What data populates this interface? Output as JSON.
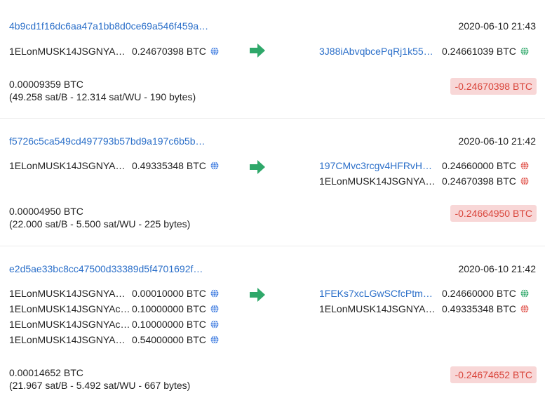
{
  "transactions": [
    {
      "hash": "4b9cd1f16dc6aa47a1bb8d0ce69a546f459a…",
      "time": "2020-06-10 21:43",
      "inputs": [
        {
          "address": "1ELonMUSK14JSGNYA…",
          "amount": "0.24670398 BTC",
          "status": "globe"
        }
      ],
      "outputs": [
        {
          "address": "3J88iAbvqbcePqRj1k55…",
          "amount": "0.24661039 BTC",
          "status": "unspent",
          "color": "#2fa86a",
          "link": true
        }
      ],
      "fee": "0.00009359 BTC",
      "fee_detail": "(49.258 sat/B - 12.314 sat/WU - 190 bytes)",
      "total": "-0.24670398 BTC"
    },
    {
      "hash": "f5726c5ca549cd497793b57bd9a197c6b5b…",
      "time": "2020-06-10 21:42",
      "inputs": [
        {
          "address": "1ELonMUSK14JSGNYA…",
          "amount": "0.49335348 BTC",
          "status": "globe"
        }
      ],
      "outputs": [
        {
          "address": "197CMvc3rcgv4HFRvH…",
          "amount": "0.24660000 BTC",
          "status": "spent",
          "color": "#e0524a",
          "link": true
        },
        {
          "address": "1ELonMUSK14JSGNYA…",
          "amount": "0.24670398 BTC",
          "status": "spent",
          "color": "#e0524a",
          "link": false
        }
      ],
      "fee": "0.00004950 BTC",
      "fee_detail": "(22.000 sat/B - 5.500 sat/WU - 225 bytes)",
      "total": "-0.24664950 BTC"
    },
    {
      "hash": "e2d5ae33bc8cc47500d33389d5f4701692f…",
      "time": "2020-06-10 21:42",
      "inputs": [
        {
          "address": "1ELonMUSK14JSGNYA…",
          "amount": "0.00010000 BTC",
          "status": "globe"
        },
        {
          "address": "1ELonMUSK14JSGNYAc…",
          "amount": "0.10000000 BTC",
          "status": "globe"
        },
        {
          "address": "1ELonMUSK14JSGNYAc…",
          "amount": "0.10000000 BTC",
          "status": "globe"
        },
        {
          "address": "1ELonMUSK14JSGNYA…",
          "amount": "0.54000000 BTC",
          "status": "globe"
        }
      ],
      "outputs": [
        {
          "address": "1FEKs7xcLGwSCfcPtm…",
          "amount": "0.24660000 BTC",
          "status": "unspent",
          "color": "#2fa86a",
          "link": true
        },
        {
          "address": "1ELonMUSK14JSGNYA…",
          "amount": "0.49335348 BTC",
          "status": "spent",
          "color": "#e0524a",
          "link": false
        }
      ],
      "fee": "0.00014652 BTC",
      "fee_detail": "(21.967 sat/B - 5.492 sat/WU - 667 bytes)",
      "total": "-0.24674652 BTC"
    }
  ],
  "colors": {
    "link": "#2b6fc9",
    "arrow": "#2fa86a",
    "globe": "#3d7be0",
    "total_bg": "#f8d7d7",
    "total_text": "#d9443a"
  },
  "icons": {
    "arrow": "arrow-right-icon",
    "input_status": "globe-icon",
    "output_status": "globe-icon"
  }
}
